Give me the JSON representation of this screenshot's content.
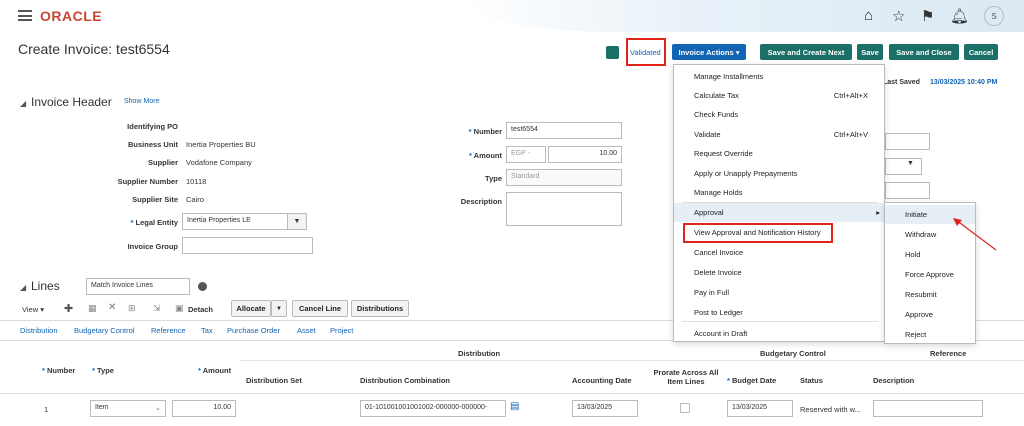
{
  "header": {
    "logo": "ORACLE",
    "avatar": "S"
  },
  "page": {
    "title": "Create Invoice: test6554",
    "last_saved_label": "Last Saved",
    "last_saved_value": "13/03/2025 10:40 PM"
  },
  "toolbar": {
    "validated": "Validated",
    "invoice_actions": "Invoice Actions",
    "save_create_next": "Save and Create Next",
    "save": "Save",
    "save_close": "Save and Close",
    "cancel": "Cancel"
  },
  "invoice_header": {
    "title": "Invoice Header",
    "show_more": "Show More",
    "identifying_po_label": "Identifying PO",
    "business_unit_label": "Business Unit",
    "business_unit_value": "Inertia Properties BU",
    "supplier_label": "Supplier",
    "supplier_value": "Vodafone Company",
    "supplier_number_label": "Supplier Number",
    "supplier_number_value": "10118",
    "supplier_site_label": "Supplier Site",
    "supplier_site_value": "Cairo",
    "legal_entity_label": "Legal Entity",
    "legal_entity_value": "Inertia Properties LE",
    "invoice_group_label": "Invoice Group",
    "number_label": "Number",
    "number_value": "test6554",
    "amount_label": "Amount",
    "currency_value": "EGP -",
    "amount_value": "10.00",
    "type_label": "Type",
    "type_value": "Standard",
    "description_label": "Description"
  },
  "invoice_actions_menu": [
    {
      "label": "Manage Installments",
      "shortcut": ""
    },
    {
      "label": "Calculate Tax",
      "shortcut": "Ctrl+Alt+X"
    },
    {
      "label": "Check Funds",
      "shortcut": ""
    },
    {
      "label": "Validate",
      "shortcut": "Ctrl+Alt+V"
    },
    {
      "label": "Request Override",
      "shortcut": ""
    },
    {
      "label": "Apply or Unapply Prepayments",
      "shortcut": ""
    },
    {
      "label": "Manage Holds",
      "shortcut": ""
    },
    {
      "label": "Approval",
      "shortcut": ""
    },
    {
      "label": "View Approval and Notification History",
      "shortcut": ""
    },
    {
      "label": "Cancel Invoice",
      "shortcut": ""
    },
    {
      "label": "Delete Invoice",
      "shortcut": ""
    },
    {
      "label": "Pay in Full",
      "shortcut": ""
    },
    {
      "label": "Post to Ledger",
      "shortcut": ""
    },
    {
      "label": "Account in Draft",
      "shortcut": ""
    }
  ],
  "approval_submenu": [
    "Initiate",
    "Withdraw",
    "Hold",
    "Force Approve",
    "Resubmit",
    "Approve",
    "Reject"
  ],
  "lines": {
    "title": "Lines",
    "match_select": "Match Invoice Lines",
    "view": "View",
    "detach": "Detach",
    "allocate": "Allocate",
    "cancel_line": "Cancel Line",
    "distributions": "Distributions",
    "tabs": [
      "Distribution",
      "Budgetary Control",
      "Reference",
      "Tax",
      "Purchase Order",
      "Asset",
      "Project"
    ],
    "group_distribution": "Distribution",
    "group_budgetary": "Budgetary Control",
    "group_reference": "Reference",
    "col_number": "Number",
    "col_type": "Type",
    "col_amount": "Amount",
    "col_dist_set": "Distribution Set",
    "col_dist_combination": "Distribution Combination",
    "col_accounting_date": "Accounting Date",
    "col_prorate": "Prorate Across All Item Lines",
    "col_budget_date": "Budget Date",
    "col_status": "Status",
    "col_description": "Description",
    "row": {
      "number": "1",
      "type": "Item",
      "amount": "10.00",
      "combination": "01-101001001001002-000000-000000-",
      "accounting_date": "13/03/2025",
      "budget_date": "13/03/2025",
      "status": "Reserved with w..."
    }
  }
}
